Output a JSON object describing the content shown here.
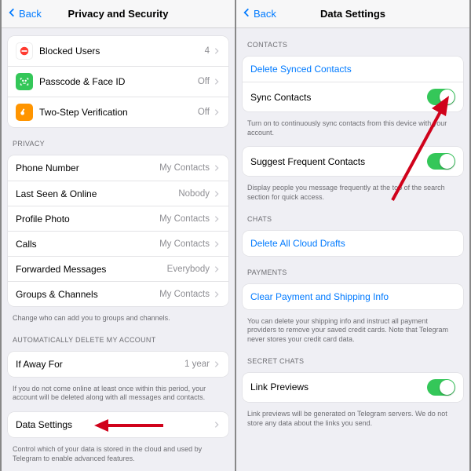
{
  "left": {
    "nav": {
      "back": "Back",
      "title": "Privacy and Security"
    },
    "security_group": [
      {
        "icon": "blocked",
        "label": "Blocked Users",
        "value": "4"
      },
      {
        "icon": "passcode",
        "label": "Passcode & Face ID",
        "value": "Off"
      },
      {
        "icon": "twostep",
        "label": "Two-Step Verification",
        "value": "Off"
      }
    ],
    "privacy_header": "PRIVACY",
    "privacy_group": [
      {
        "label": "Phone Number",
        "value": "My Contacts"
      },
      {
        "label": "Last Seen & Online",
        "value": "Nobody"
      },
      {
        "label": "Profile Photo",
        "value": "My Contacts"
      },
      {
        "label": "Calls",
        "value": "My Contacts"
      },
      {
        "label": "Forwarded Messages",
        "value": "Everybody"
      },
      {
        "label": "Groups & Channels",
        "value": "My Contacts"
      }
    ],
    "privacy_footer": "Change who can add you to groups and channels.",
    "auto_header": "AUTOMATICALLY DELETE MY ACCOUNT",
    "auto_row": {
      "label": "If Away For",
      "value": "1 year"
    },
    "auto_footer": "If you do not come online at least once within this period, your account will be deleted along with all messages and contacts.",
    "data_row": {
      "label": "Data Settings"
    },
    "data_footer": "Control which of your data is stored in the cloud and used by Telegram to enable advanced features."
  },
  "right": {
    "nav": {
      "back": "Back",
      "title": "Data Settings"
    },
    "contacts_header": "CONTACTS",
    "delete_synced": "Delete Synced Contacts",
    "sync_contacts": "Sync Contacts",
    "sync_footer": "Turn on to continuously sync contacts from this device with your account.",
    "suggest": "Suggest Frequent Contacts",
    "suggest_footer": "Display people you message frequently at the top of the search section for quick access.",
    "chats_header": "CHATS",
    "delete_drafts": "Delete All Cloud Drafts",
    "payments_header": "PAYMENTS",
    "clear_payment": "Clear Payment and Shipping Info",
    "payment_footer": "You can delete your shipping info and instruct all payment providers to remove your saved credit cards. Note that Telegram never stores your credit card data.",
    "secret_header": "SECRET CHATS",
    "link_previews": "Link Previews",
    "link_footer": "Link previews will be generated on Telegram servers. We do not store any data about the links you send."
  }
}
